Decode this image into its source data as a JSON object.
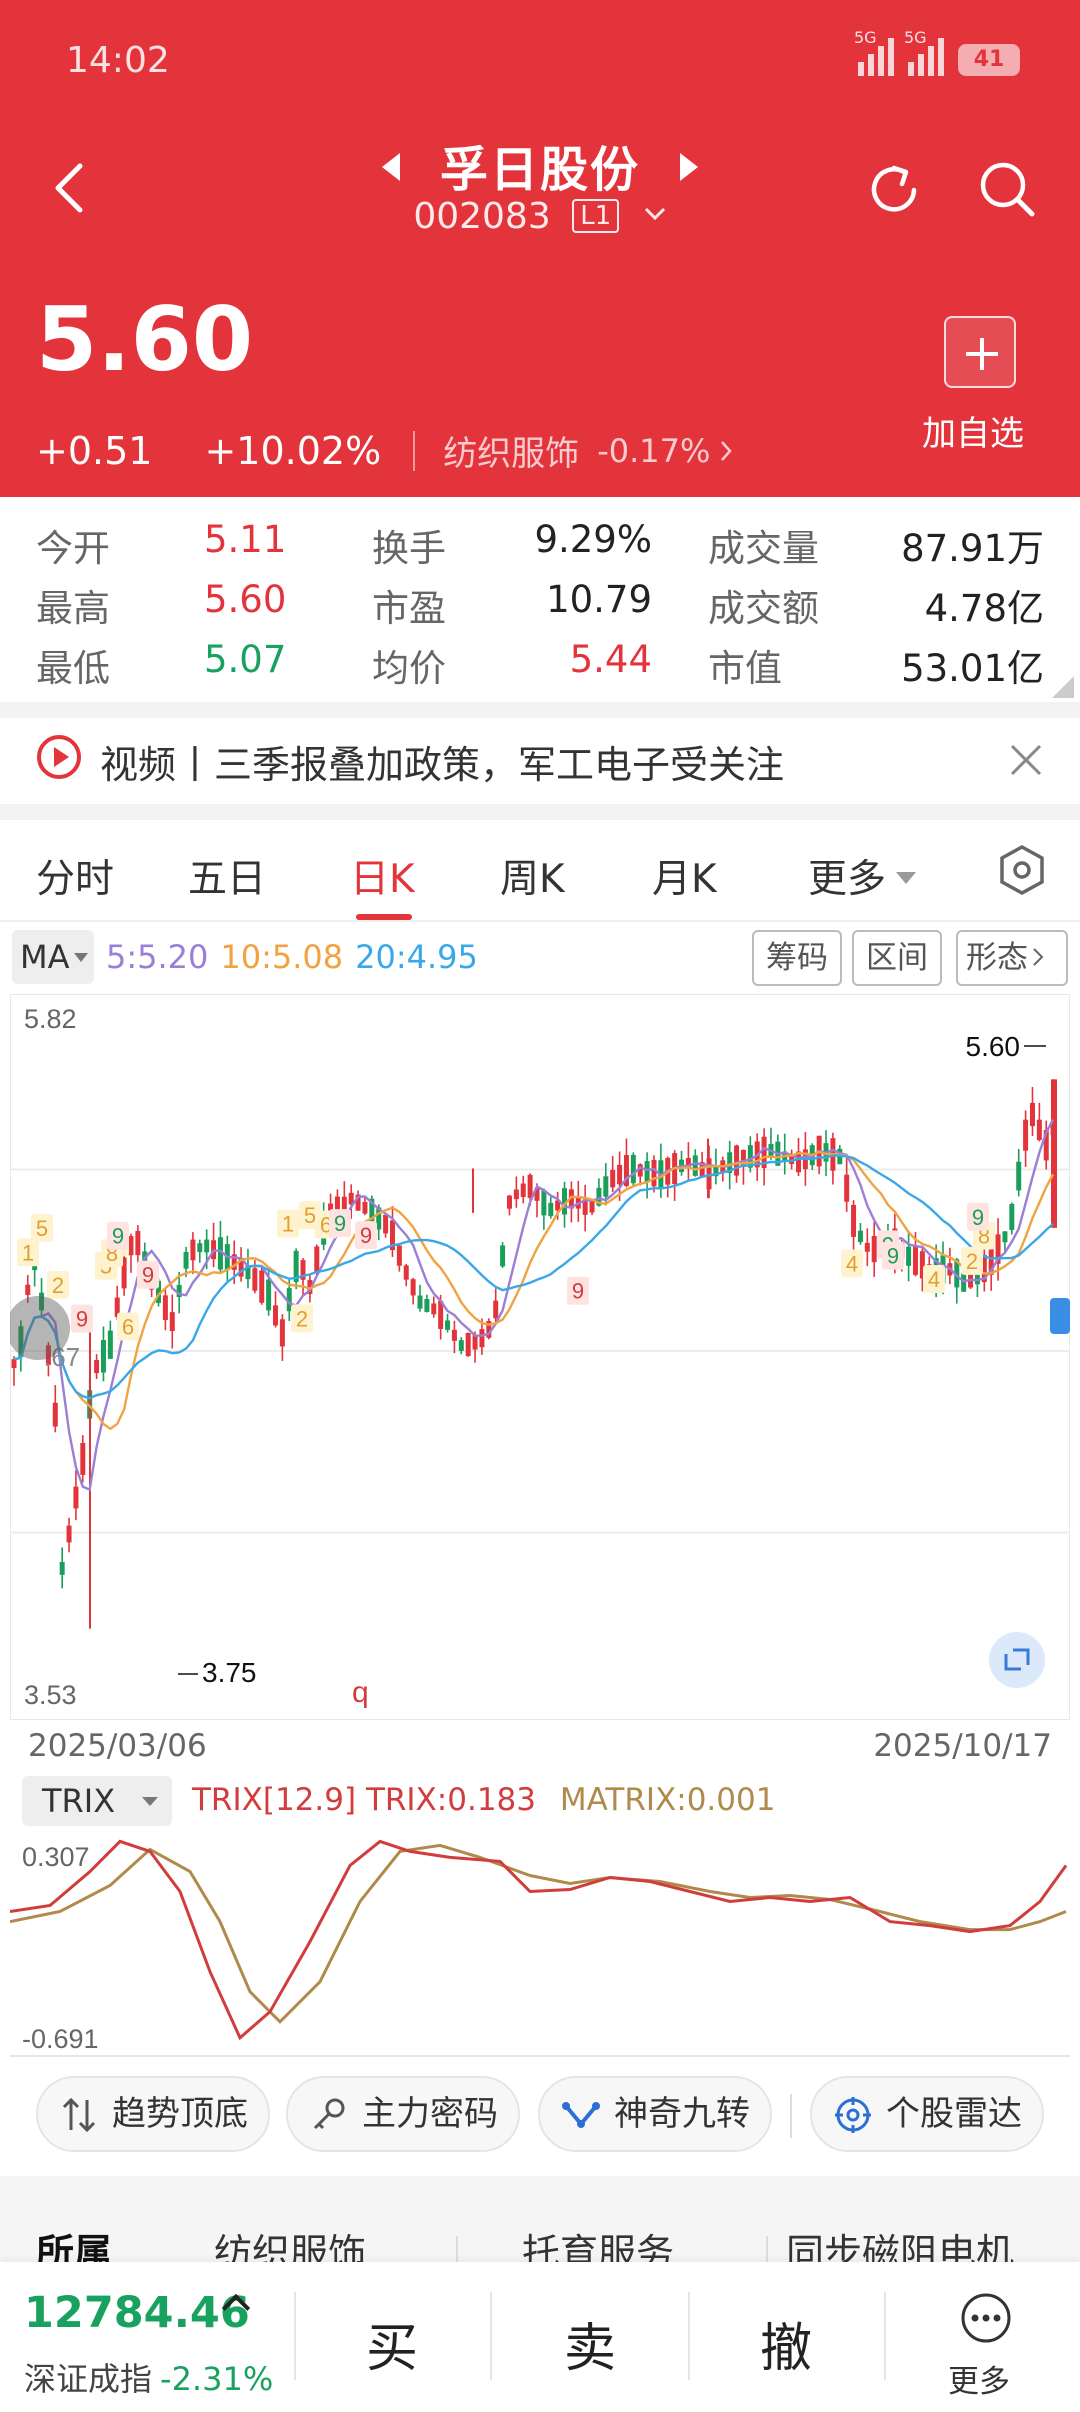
{
  "status": {
    "time": "14:02",
    "signal_label_1": "5G",
    "signal_label_2": "5G",
    "battery": "41"
  },
  "header": {
    "stock_name": "孚日股份",
    "stock_code": "002083",
    "level_badge": "L1",
    "price": "5.60",
    "change": "+0.51",
    "change_pct": "+10.02%",
    "industry": "纺织服饰",
    "industry_change": "-0.17%",
    "add_watch_label": "加自选"
  },
  "stats": [
    [
      {
        "label": "今开",
        "value": "5.11"
      },
      {
        "label": "换手",
        "value": "9.29%"
      },
      {
        "label": "成交量",
        "value": "87.91万"
      }
    ],
    [
      {
        "label": "最高",
        "value": "5.60"
      },
      {
        "label": "市盈",
        "value": "10.79"
      },
      {
        "label": "成交额",
        "value": "4.78亿"
      }
    ],
    [
      {
        "label": "最低",
        "value": "5.07"
      },
      {
        "label": "均价",
        "value": "5.44"
      },
      {
        "label": "市值",
        "value": "53.01亿"
      }
    ]
  ],
  "news": {
    "text": "视频丨三季报叠加政策，军工电子受关注"
  },
  "tabs": [
    "分时",
    "五日",
    "日K",
    "周K",
    "月K",
    "更多"
  ],
  "active_tab": "日K",
  "ma": {
    "selector": "MA",
    "ma5": "5:5.20",
    "ma10": "10:5.08",
    "ma20": "20:4.95"
  },
  "tools": [
    "筹码",
    "区间",
    "形态"
  ],
  "kchart": {
    "y_max_label": "5.82",
    "y_min_label": "3.53",
    "mid_label": ".67",
    "high_marker": "5.60",
    "low_marker": "3.75",
    "date_start": "2025/03/06",
    "date_end": "2025/10/17",
    "nine_turn_labels": [
      "1",
      "5",
      "9",
      "2",
      "5",
      "6",
      "9",
      "7",
      "8",
      "9",
      "9",
      "1",
      "2",
      "5",
      "6",
      "9",
      "9",
      "9",
      "4",
      "9",
      "2",
      "4",
      "8",
      "9"
    ],
    "q_mark": "q",
    "colors": {
      "up": "#e3343c",
      "down": "#1a9e5a",
      "ma5": "#9b7fd6",
      "ma10": "#f0a340",
      "ma20": "#3aa8e8"
    }
  },
  "trix": {
    "selector": "TRIX",
    "params": "TRIX[12.9]",
    "trix_val": "TRIX:0.183",
    "matrix_val": "MATRIX:0.001",
    "y_max_label": "0.307",
    "y_min_label": "-0.691",
    "colors": {
      "trix": "#d23c3c",
      "matrix": "#b08a4a"
    }
  },
  "strategies": [
    {
      "label": "趋势顶底",
      "icon": "trend-arrows-icon"
    },
    {
      "label": "主力密码",
      "icon": "key-icon"
    },
    {
      "label": "神奇九转",
      "icon": "nine-turn-icon"
    },
    {
      "label": "个股雷达",
      "icon": "radar-icon"
    }
  ],
  "related": [
    "所属",
    "纺织服饰",
    "托育服务",
    "同步磁阻电机"
  ],
  "bottom": {
    "index_value": "12784.46",
    "index_name": "深证成指",
    "index_change": "-2.31%",
    "buy": "买",
    "sell": "卖",
    "cancel": "撤",
    "more": "更多"
  }
}
